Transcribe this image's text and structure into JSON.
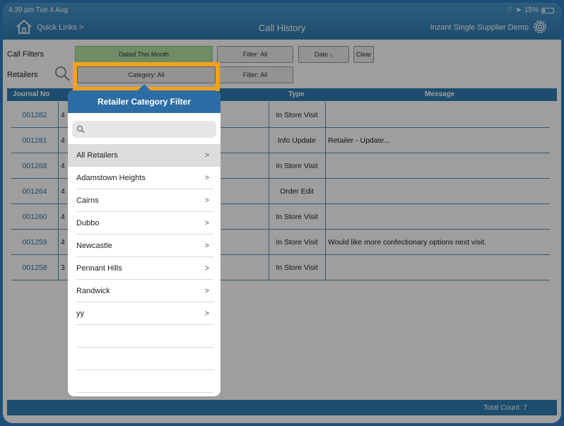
{
  "status": {
    "time": "4:39 pm  Tue 4 Aug",
    "battery": "15%"
  },
  "header": {
    "quick_links": "Quick Links >",
    "title": "Call History",
    "account": "Inzant Single Supplier Demo"
  },
  "filters": {
    "call_filters_label": "Call Filters",
    "retailers_label": "Retailers",
    "dated": "Dated This Month",
    "call_filter": "Filter: All",
    "date_sort": "Date ↓",
    "clear": "Clear",
    "category": "Category: All",
    "retailer_filter": "Filter: All"
  },
  "table": {
    "columns": {
      "journal": "Journal No",
      "type": "Type",
      "message": "Message"
    },
    "rows": [
      {
        "journal": "001282",
        "date": "4",
        "type": "In Store Visit",
        "message": ""
      },
      {
        "journal": "001281",
        "date": "4",
        "type": "Info Update",
        "message": "Retailer - Update..."
      },
      {
        "journal": "001268",
        "date": "4",
        "type": "In Store Visit",
        "message": ""
      },
      {
        "journal": "001264",
        "date": "4",
        "type": "Order Edit",
        "message": ""
      },
      {
        "journal": "001260",
        "date": "4",
        "type": "In Store Visit",
        "message": ""
      },
      {
        "journal": "001259",
        "date": "4",
        "type": "In Store Visit",
        "message": "Would like more confectionary options next visit."
      },
      {
        "journal": "001258",
        "date": "3",
        "type": "In Store Visit",
        "message": ""
      }
    ]
  },
  "footer": {
    "total": "Total Count: 7"
  },
  "popover": {
    "title": "Retailer Category Filter",
    "search_placeholder": "",
    "chevron": ">",
    "items": [
      "All Retailers",
      "Adamstown Heights",
      "Cairns",
      "Dubbo",
      "Newcastle",
      "Pennant Hills",
      "Randwick",
      "yy"
    ],
    "selected_index": 0
  },
  "colors": {
    "header_blue": "#2f7cb2",
    "highlight_orange": "#f4a11c",
    "link_blue": "#2c74b4",
    "dated_green": "#b4e3a7"
  }
}
